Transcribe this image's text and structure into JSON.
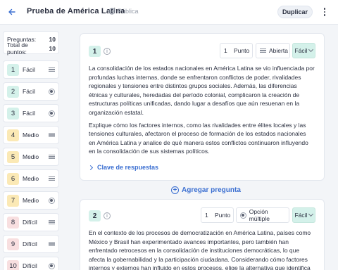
{
  "header": {
    "title": "Prueba de América Latina",
    "visibility": "Pública",
    "duplicate_label": "Duplicar"
  },
  "summary": {
    "questions_label": "Preguntas:",
    "questions_value": "10",
    "points_label": "Total de puntos:",
    "points_value": "10"
  },
  "question_nav": [
    {
      "number": "1",
      "difficulty": "Fácil",
      "type": "text"
    },
    {
      "number": "2",
      "difficulty": "Fácil",
      "type": "radio"
    },
    {
      "number": "3",
      "difficulty": "Fácil",
      "type": "radio"
    },
    {
      "number": "4",
      "difficulty": "Medio",
      "type": "text"
    },
    {
      "number": "5",
      "difficulty": "Medio",
      "type": "text"
    },
    {
      "number": "6",
      "difficulty": "Medio",
      "type": "text"
    },
    {
      "number": "7",
      "difficulty": "Medio",
      "type": "radio"
    },
    {
      "number": "8",
      "difficulty": "Difícil",
      "type": "text"
    },
    {
      "number": "9",
      "difficulty": "Difícil",
      "type": "text"
    },
    {
      "number": "10",
      "difficulty": "Difícil",
      "type": "radio"
    }
  ],
  "questions": [
    {
      "number": "1",
      "points": "1",
      "points_label": "Punto",
      "type_label": "Abierta",
      "difficulty": "Fácil",
      "paragraphs": [
        [
          "La consolidación de los estados nacionales en América Latina se vio influenciada por",
          "profundas luchas internas, donde se enfrentaron conflictos de poder, rivalidades",
          "regionales y tensiones entre distintos grupos sociales. Además, las diferencias",
          "étnicas y culturales, heredadas del período colonial, complicaron la creación de",
          "estructuras políticas unificadas, dando lugar a desafíos que aún resuenan en la",
          "organización estatal."
        ],
        [
          "Explique cómo los factores internos, como las rivalidades entre élites locales y las",
          "tensiones culturales, afectaron el proceso de formación de los estados nacionales",
          "en América Latina y analice de qué manera estos conflictos continuaron influyendo",
          "en la consolidación de sus sistemas políticos."
        ]
      ],
      "answer_key_label": "Clave de respuestas"
    },
    {
      "number": "2",
      "points": "1",
      "points_label": "Punto",
      "type_label": "Opción múltiple",
      "difficulty": "Fácil",
      "paragraphs": [
        [
          "En el contexto de los procesos de democratización en América Latina, países como",
          "México y Brasil han experimentado avances importantes, pero también han",
          "enfrentado retrocesos en la consolidación de instituciones democráticas, lo que",
          "afecta la gobernabilidad y la participación ciudadana. Considerando cómo factores",
          "internos y externos han influido en estos procesos, elige la alternativa que identifica"
        ]
      ]
    }
  ],
  "add_question_label": "Agregar pregunta",
  "colors": {
    "accent": "#3b6fd1",
    "easy": "#d4f1ea",
    "medium": "#fbe9b5",
    "hard": "#f8dfe0"
  },
  "icons": {
    "back": "arrow-left-icon",
    "visibility": "globe-icon",
    "more": "more-vertical-icon",
    "open_type": "lines-icon",
    "multiple_type": "radio-icon"
  }
}
